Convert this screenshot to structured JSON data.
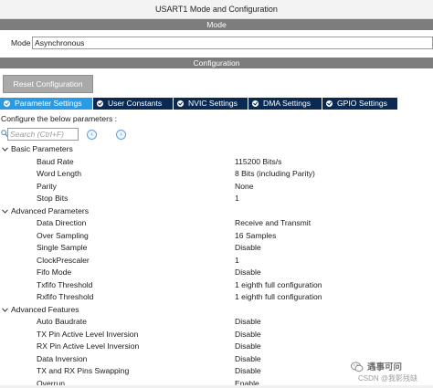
{
  "window": {
    "title": "USART1 Mode and Configuration"
  },
  "mode_section": {
    "header": "Mode",
    "mode_label": "Mode",
    "mode_value": "Asynchronous"
  },
  "config_section": {
    "header": "Configuration",
    "reset_label": "Reset Configuration",
    "tabs": [
      {
        "label": "Parameter Settings",
        "active": true
      },
      {
        "label": "User Constants",
        "active": false
      },
      {
        "label": "NVIC Settings",
        "active": false
      },
      {
        "label": "DMA Settings",
        "active": false
      },
      {
        "label": "GPIO Settings",
        "active": false
      }
    ],
    "configure_text": "Configure the below parameters :",
    "search_placeholder": "Search (Ctrl+F)",
    "groups": [
      {
        "name": "Basic Parameters",
        "params": [
          {
            "name": "Baud Rate",
            "value": "115200 Bits/s"
          },
          {
            "name": "Word Length",
            "value": "8 Bits (including Parity)"
          },
          {
            "name": "Parity",
            "value": "None"
          },
          {
            "name": "Stop Bits",
            "value": "1"
          }
        ]
      },
      {
        "name": "Advanced Parameters",
        "params": [
          {
            "name": "Data Direction",
            "value": "Receive and Transmit"
          },
          {
            "name": "Over Sampling",
            "value": "16 Samples"
          },
          {
            "name": "Single Sample",
            "value": "Disable"
          },
          {
            "name": "ClockPrescaler",
            "value": "1"
          },
          {
            "name": "Fifo Mode",
            "value": "Disable"
          },
          {
            "name": "Txfifo Threshold",
            "value": "1 eighth full configuration"
          },
          {
            "name": "Rxfifo Threshold",
            "value": "1 eighth full configuration"
          }
        ]
      },
      {
        "name": "Advanced Features",
        "params": [
          {
            "name": "Auto Baudrate",
            "value": "Disable"
          },
          {
            "name": "TX Pin Active Level Inversion",
            "value": "Disable"
          },
          {
            "name": "RX Pin Active Level Inversion",
            "value": "Disable"
          },
          {
            "name": "Data Inversion",
            "value": "Disable"
          },
          {
            "name": "TX and RX Pins Swapping",
            "value": "Disable"
          },
          {
            "name": "Overrun",
            "value": "Enable"
          }
        ]
      }
    ]
  },
  "watermark": {
    "line1": "遇事可问",
    "line2": "CSDN @我影残缺"
  },
  "colors": {
    "section_bar": "#7d7d7d",
    "tab_active": "#2b9ae5",
    "tab_inactive": "#0a2a52"
  },
  "icons": {
    "tab": "check-circle-icon",
    "search": "search-icon",
    "prev": "previous-match-icon",
    "next": "next-match-icon",
    "group_toggle": "chevron-down-icon",
    "watermark_logo": "wechat-logo-icon"
  }
}
